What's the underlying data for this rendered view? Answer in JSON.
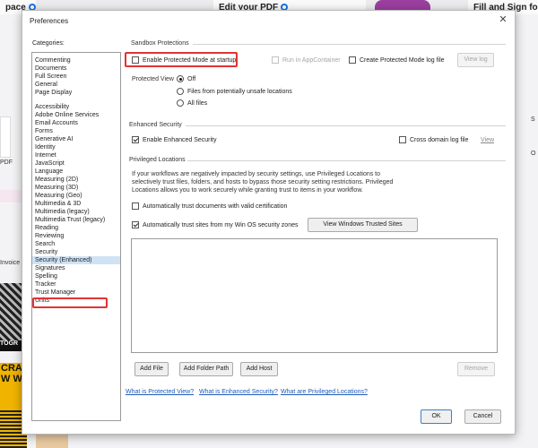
{
  "background": {
    "tiles": [
      "pace",
      "Edit your PDF",
      "Fill and Sign forms"
    ],
    "side_labels": [
      "PDF",
      "Invoice",
      "S",
      "O"
    ],
    "images": [
      "TOGR",
      "CRAFT\nW WO"
    ]
  },
  "dialog": {
    "title": "Preferences",
    "close_glyph": "✕",
    "categories_label": "Categories:",
    "category_groups": [
      [
        "Commenting",
        "Documents",
        "Full Screen",
        "General",
        "Page Display"
      ],
      [
        "Accessibility",
        "Adobe Online Services",
        "Email Accounts",
        "Forms",
        "Generative AI",
        "Identity",
        "Internet",
        "JavaScript",
        "Language",
        "Measuring (2D)",
        "Measuring (3D)",
        "Measuring (Geo)",
        "Multimedia & 3D",
        "Multimedia (legacy)",
        "Multimedia Trust (legacy)",
        "Reading",
        "Reviewing",
        "Search",
        "Security",
        "Security (Enhanced)",
        "Signatures",
        "Spelling",
        "Tracker",
        "Trust Manager",
        "Units"
      ]
    ],
    "selected_category": "Security (Enhanced)",
    "sandbox": {
      "title": "Sandbox Protections",
      "protected_mode": "Enable Protected Mode at startup",
      "run_in_appcontainer": "Run in AppContainer",
      "create_log": "Create Protected Mode log file",
      "view_log": "View log",
      "protected_view_label": "Protected View",
      "pv_options": [
        "Off",
        "Files from potentially unsafe locations",
        "All files"
      ],
      "pv_selected": "Off"
    },
    "enhanced": {
      "title": "Enhanced Security",
      "enable": "Enable Enhanced Security",
      "cross_domain": "Cross domain log file",
      "view": "View"
    },
    "privileged": {
      "title": "Privileged Locations",
      "description": "If your workflows are negatively impacted by security settings, use Privileged Locations to selectively trust files, folders, and hosts to bypass those security setting restrictions. Privileged Locations allows you to work securely while granting trust to items in your workflow.",
      "auto_trust_cert": "Automatically trust documents with valid certification",
      "auto_trust_sites": "Automatically trust sites from my Win OS security zones",
      "view_trusted": "View Windows Trusted Sites",
      "add_file": "Add File",
      "add_folder": "Add Folder Path",
      "add_host": "Add Host",
      "remove": "Remove"
    },
    "links": [
      "What is Protected View?",
      "What is Enhanced Security?",
      "What are Privileged Locations?"
    ],
    "ok": "OK",
    "cancel": "Cancel"
  },
  "colors": {
    "accent": "#1473e6",
    "highlight": "#e03434",
    "selection": "#cfe3f5",
    "link": "#1e5bb8"
  }
}
